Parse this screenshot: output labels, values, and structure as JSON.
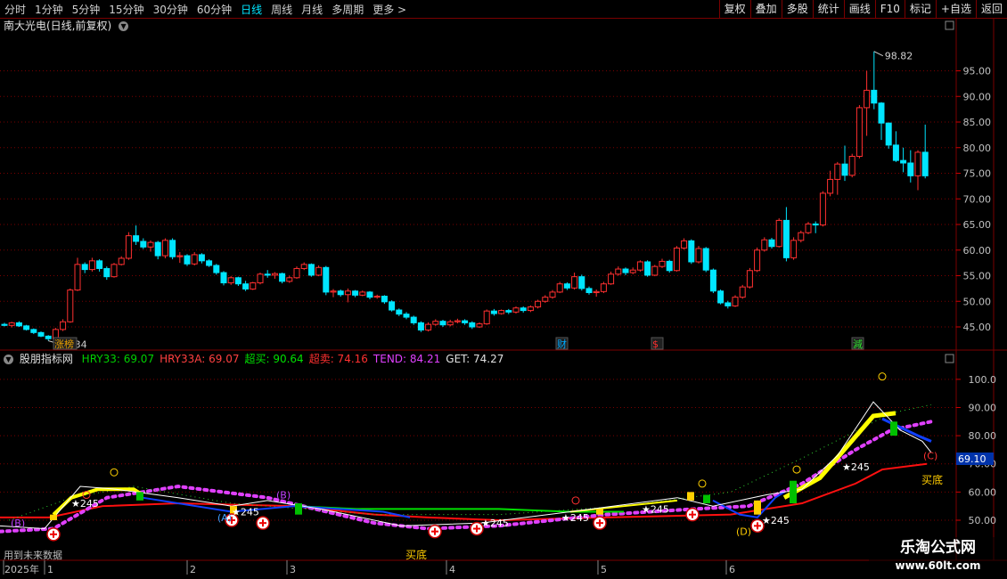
{
  "toolbar": {
    "periods": [
      "分时",
      "1分钟",
      "5分钟",
      "15分钟",
      "30分钟",
      "60分钟",
      "日线",
      "周线",
      "月线",
      "多周期",
      "更多 >"
    ],
    "active": "日线",
    "right_buttons": [
      "复权",
      "叠加",
      "多股",
      "统计",
      "画线",
      "F10",
      "标记",
      "+自选",
      "返回"
    ]
  },
  "main_title": "南大光电(日线,前复权)",
  "price_axis": [
    "95.00",
    "90.00",
    "85.00",
    "80.00",
    "75.00",
    "70.00",
    "65.00",
    "60.00",
    "55.00",
    "50.00",
    "45.00"
  ],
  "annotations": {
    "high": "98.82",
    "low": "42.34"
  },
  "event_tags": [
    {
      "label": "涨榜",
      "color": "#e8a000"
    },
    {
      "label": "财",
      "color": "#00aaff"
    },
    {
      "label": "$",
      "color": "#ff3030"
    },
    {
      "label": "減",
      "color": "#30e030"
    }
  ],
  "indicator": {
    "name": "股朋指标网",
    "values": [
      {
        "label": "HRY33: 69.07",
        "color": "#00d000"
      },
      {
        "label": "HRY33A: 69.07",
        "color": "#ff4040"
      },
      {
        "label": "超买: 90.64",
        "color": "#00e000"
      },
      {
        "label": "超卖: 74.16",
        "color": "#ff3030"
      },
      {
        "label": "TEND: 84.21",
        "color": "#e040ff"
      },
      {
        "label": "GET: 74.27",
        "color": "#e0e0e0"
      }
    ],
    "axis": [
      "100.0",
      "90.00",
      "80.00",
      "70.00",
      "60.00",
      "50.00"
    ],
    "current_value": "69.10",
    "signals": {
      "buy_bottom": "买底",
      "star245": "★245"
    },
    "marks": [
      "(B)",
      "(A)",
      "(B)",
      "(C)",
      "(D)"
    ],
    "future_note": "用到未来数据"
  },
  "date_axis": [
    "2025年",
    "1",
    "2",
    "3",
    "4",
    "5",
    "6"
  ],
  "watermark": {
    "line1": "乐淘公式网",
    "line2": "www.60lt.com"
  },
  "colors": {
    "up": "#ff3030",
    "down": "#00e5ff",
    "grid": "#7a0000"
  },
  "chart_data": {
    "type": "candlestick",
    "unit": "price",
    "ylim": [
      41,
      101
    ],
    "candles": [
      [
        45.5,
        45.8,
        45.1,
        45.3
      ],
      [
        45.3,
        46.0,
        44.9,
        45.8
      ],
      [
        45.8,
        46.1,
        45.0,
        45.2
      ],
      [
        45.2,
        45.4,
        44.3,
        44.5
      ],
      [
        44.5,
        44.7,
        43.6,
        43.9
      ],
      [
        43.9,
        44.1,
        43.0,
        43.2
      ],
      [
        43.2,
        43.4,
        42.3,
        42.7
      ],
      [
        42.7,
        44.8,
        42.5,
        44.5
      ],
      [
        44.5,
        46.5,
        44.2,
        46.0
      ],
      [
        46.0,
        52.5,
        45.8,
        52.2
      ],
      [
        52.2,
        58.5,
        52.0,
        57.2
      ],
      [
        57.2,
        57.6,
        55.5,
        56.2
      ],
      [
        56.2,
        58.5,
        55.8,
        57.9
      ],
      [
        57.9,
        58.2,
        55.8,
        56.4
      ],
      [
        56.4,
        56.8,
        54.2,
        54.8
      ],
      [
        54.8,
        57.5,
        54.6,
        57.2
      ],
      [
        57.2,
        58.8,
        57.0,
        58.4
      ],
      [
        58.4,
        63.5,
        58.1,
        62.8
      ],
      [
        62.8,
        64.8,
        61.0,
        61.7
      ],
      [
        61.7,
        62.3,
        60.2,
        60.6
      ],
      [
        60.6,
        61.9,
        59.7,
        61.5
      ],
      [
        61.5,
        61.8,
        58.2,
        58.9
      ],
      [
        58.9,
        62.3,
        58.4,
        61.9
      ],
      [
        61.9,
        62.3,
        58.2,
        58.7
      ],
      [
        58.7,
        59.6,
        57.5,
        58.9
      ],
      [
        58.9,
        59.2,
        56.9,
        57.3
      ],
      [
        57.3,
        59.6,
        57.0,
        59.1
      ],
      [
        59.1,
        59.4,
        57.4,
        57.9
      ],
      [
        57.9,
        58.2,
        56.7,
        57.0
      ],
      [
        57.0,
        57.3,
        55.2,
        55.6
      ],
      [
        55.6,
        55.9,
        53.1,
        53.6
      ],
      [
        53.6,
        54.9,
        53.2,
        54.6
      ],
      [
        54.6,
        54.8,
        53.0,
        53.4
      ],
      [
        53.4,
        54.0,
        52.0,
        52.4
      ],
      [
        52.4,
        53.8,
        52.2,
        53.6
      ],
      [
        53.6,
        55.6,
        53.3,
        55.3
      ],
      [
        55.3,
        56.1,
        54.6,
        55.1
      ],
      [
        55.1,
        55.7,
        54.4,
        55.4
      ],
      [
        55.4,
        55.6,
        53.5,
        53.9
      ],
      [
        53.9,
        55.0,
        53.6,
        54.6
      ],
      [
        54.6,
        56.8,
        54.4,
        56.4
      ],
      [
        56.4,
        57.6,
        56.1,
        57.2
      ],
      [
        57.2,
        57.4,
        54.8,
        55.1
      ],
      [
        55.1,
        57.0,
        54.9,
        56.6
      ],
      [
        56.6,
        56.9,
        51.2,
        51.8
      ],
      [
        51.8,
        52.4,
        50.8,
        52.0
      ],
      [
        52.0,
        52.3,
        50.9,
        51.3
      ],
      [
        51.3,
        52.5,
        49.8,
        52.0
      ],
      [
        52.0,
        52.2,
        50.8,
        51.2
      ],
      [
        51.2,
        52.1,
        51.0,
        51.8
      ],
      [
        51.8,
        52.0,
        50.4,
        50.8
      ],
      [
        50.8,
        51.3,
        50.5,
        51.0
      ],
      [
        51.0,
        51.2,
        49.5,
        49.9
      ],
      [
        49.9,
        50.2,
        48.0,
        48.3
      ],
      [
        48.3,
        48.6,
        47.1,
        47.5
      ],
      [
        47.5,
        47.9,
        46.5,
        46.9
      ],
      [
        46.9,
        47.2,
        45.4,
        45.8
      ],
      [
        45.8,
        46.1,
        44.0,
        44.4
      ],
      [
        44.4,
        45.9,
        44.1,
        45.5
      ],
      [
        45.5,
        46.5,
        45.2,
        46.1
      ],
      [
        46.1,
        46.4,
        45.0,
        45.4
      ],
      [
        45.4,
        46.4,
        45.1,
        46.0
      ],
      [
        46.0,
        46.6,
        45.7,
        46.2
      ],
      [
        46.2,
        46.5,
        45.4,
        45.8
      ],
      [
        45.8,
        46.1,
        44.6,
        45.0
      ],
      [
        45.0,
        45.9,
        44.8,
        45.6
      ],
      [
        45.6,
        48.4,
        45.4,
        48.1
      ],
      [
        48.1,
        48.5,
        47.2,
        47.6
      ],
      [
        47.6,
        48.4,
        47.4,
        48.2
      ],
      [
        48.2,
        48.5,
        47.5,
        47.9
      ],
      [
        47.9,
        49.0,
        47.6,
        48.7
      ],
      [
        48.7,
        49.0,
        47.8,
        48.2
      ],
      [
        48.2,
        49.2,
        47.9,
        48.9
      ],
      [
        48.9,
        50.3,
        48.6,
        50.0
      ],
      [
        50.0,
        51.2,
        49.7,
        50.8
      ],
      [
        50.8,
        52.2,
        50.5,
        51.8
      ],
      [
        51.8,
        53.8,
        51.6,
        53.4
      ],
      [
        53.4,
        53.7,
        52.2,
        52.6
      ],
      [
        52.6,
        55.6,
        52.3,
        54.8
      ],
      [
        54.8,
        55.2,
        52.1,
        52.5
      ],
      [
        52.5,
        52.9,
        51.3,
        51.7
      ],
      [
        51.7,
        52.3,
        50.9,
        51.9
      ],
      [
        51.9,
        53.8,
        51.6,
        53.4
      ],
      [
        53.4,
        55.8,
        53.2,
        55.3
      ],
      [
        55.3,
        56.8,
        55.0,
        56.3
      ],
      [
        56.3,
        56.6,
        55.1,
        55.6
      ],
      [
        55.6,
        56.6,
        55.3,
        56.1
      ],
      [
        56.1,
        58.0,
        55.8,
        57.7
      ],
      [
        57.7,
        58.0,
        54.8,
        55.1
      ],
      [
        55.1,
        57.1,
        54.9,
        56.8
      ],
      [
        56.8,
        58.3,
        56.5,
        57.8
      ],
      [
        57.8,
        58.1,
        55.6,
        56.0
      ],
      [
        56.0,
        60.8,
        55.8,
        60.4
      ],
      [
        60.4,
        62.3,
        60.1,
        61.8
      ],
      [
        61.8,
        62.1,
        57.3,
        57.7
      ],
      [
        57.7,
        60.8,
        57.4,
        60.3
      ],
      [
        60.3,
        60.6,
        55.7,
        56.1
      ],
      [
        56.1,
        56.4,
        51.6,
        52.0
      ],
      [
        52.0,
        52.3,
        49.4,
        49.7
      ],
      [
        49.7,
        50.1,
        48.6,
        49.1
      ],
      [
        49.1,
        51.2,
        48.9,
        50.8
      ],
      [
        50.8,
        53.2,
        50.5,
        52.8
      ],
      [
        52.8,
        56.5,
        52.5,
        56.0
      ],
      [
        56.0,
        60.5,
        55.7,
        60.0
      ],
      [
        60.0,
        62.5,
        59.7,
        62.0
      ],
      [
        62.0,
        62.4,
        60.3,
        60.7
      ],
      [
        60.7,
        66.2,
        60.5,
        65.8
      ],
      [
        65.8,
        68.4,
        57.8,
        58.5
      ],
      [
        58.5,
        62.5,
        58.1,
        61.9
      ],
      [
        61.9,
        63.8,
        61.5,
        63.4
      ],
      [
        63.4,
        65.5,
        63.1,
        65.1
      ],
      [
        65.1,
        65.6,
        63.3,
        64.9
      ],
      [
        64.9,
        71.5,
        64.6,
        71.1
      ],
      [
        71.1,
        75.5,
        70.5,
        73.8
      ],
      [
        73.8,
        77.2,
        70.8,
        76.8
      ],
      [
        76.8,
        80.4,
        73.5,
        74.6
      ],
      [
        74.6,
        78.8,
        74.2,
        78.3
      ],
      [
        78.3,
        88.3,
        77.9,
        87.8
      ],
      [
        87.8,
        95.0,
        82.3,
        91.2
      ],
      [
        91.2,
        98.8,
        87.5,
        88.7
      ],
      [
        88.7,
        88.9,
        81.5,
        84.8
      ],
      [
        84.8,
        84.9,
        79.8,
        80.5
      ],
      [
        80.5,
        83.2,
        77.2,
        77.5
      ],
      [
        77.5,
        80.0,
        75.2,
        77.0
      ],
      [
        77.0,
        79.5,
        73.2,
        74.5
      ],
      [
        74.5,
        79.5,
        71.7,
        79.1
      ],
      [
        79.1,
        84.5,
        74.0,
        74.5
      ]
    ]
  }
}
